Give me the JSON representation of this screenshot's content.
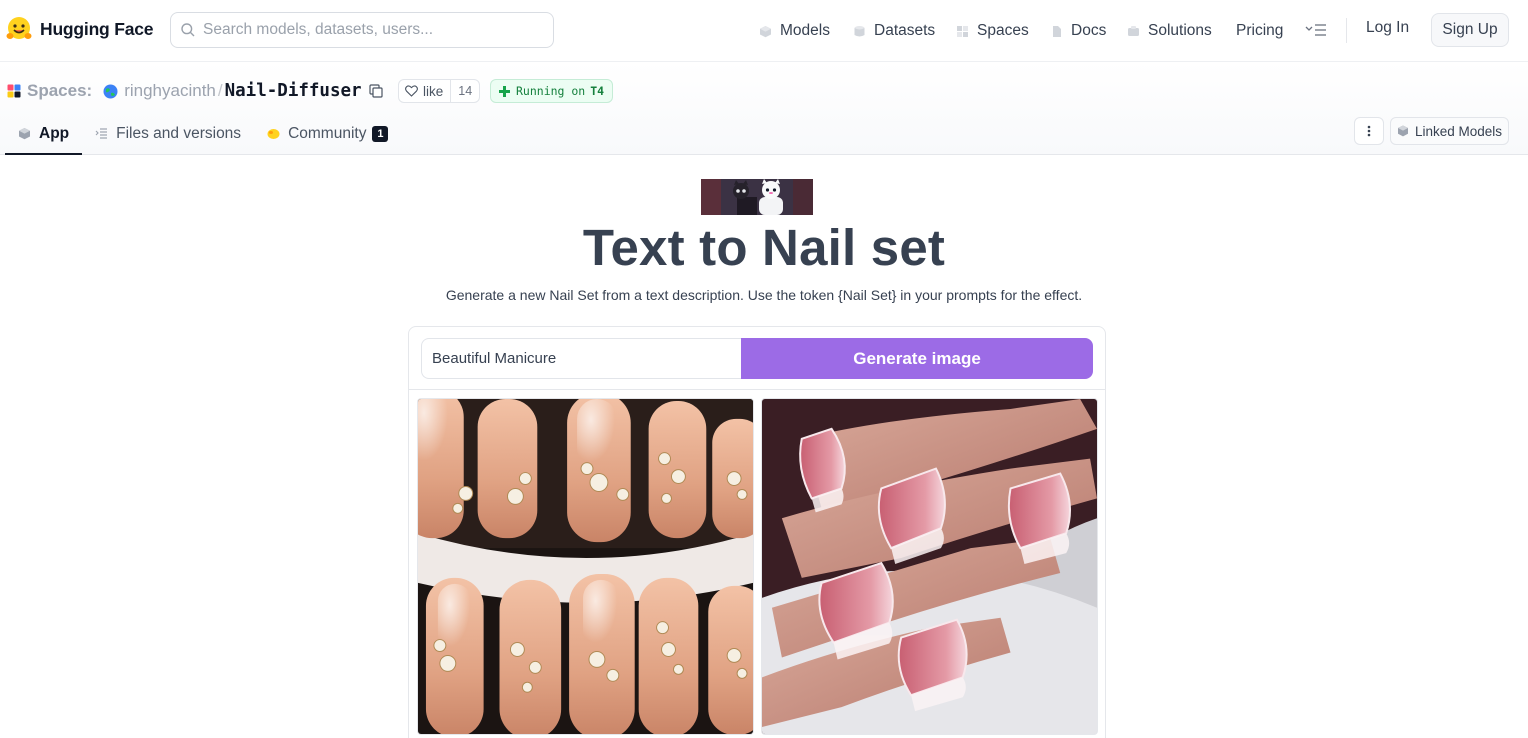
{
  "nav": {
    "brand": "Hugging Face",
    "search_placeholder": "Search models, datasets, users...",
    "links": {
      "models": "Models",
      "datasets": "Datasets",
      "spaces": "Spaces",
      "docs": "Docs",
      "solutions": "Solutions",
      "pricing": "Pricing"
    },
    "login": "Log In",
    "signup": "Sign Up"
  },
  "space": {
    "section_label": "Spaces:",
    "owner": "ringhyacinth",
    "separator": "/",
    "repo": "Nail-Diffuser",
    "like_label": "like",
    "like_count": "14",
    "status_prefix": "Running on",
    "hardware": "T4",
    "tabs": {
      "app": "App",
      "files": "Files and versions",
      "community": "Community",
      "community_count": "1"
    },
    "linked_models": "Linked Models"
  },
  "app": {
    "title": "Text to Nail set",
    "description": "Generate a new Nail Set from a text description. Use the token {Nail Set} in your prompts for the effect.",
    "prompt_value": "Beautiful Manicure",
    "generate_label": "Generate image"
  },
  "colors": {
    "accent": "#9c6be6",
    "running_green": "#15803d",
    "title_gray": "#374151"
  },
  "icons": [
    "hf-logo-icon",
    "search-icon",
    "models-icon",
    "datasets-icon",
    "spaces-icon",
    "docs-icon",
    "solutions-icon",
    "menu-icon",
    "spaces-grid-icon",
    "globe-icon",
    "copy-icon",
    "heart-icon",
    "plus-icon",
    "app-icon",
    "files-icon",
    "community-icon",
    "more-icon",
    "linked-models-icon"
  ]
}
